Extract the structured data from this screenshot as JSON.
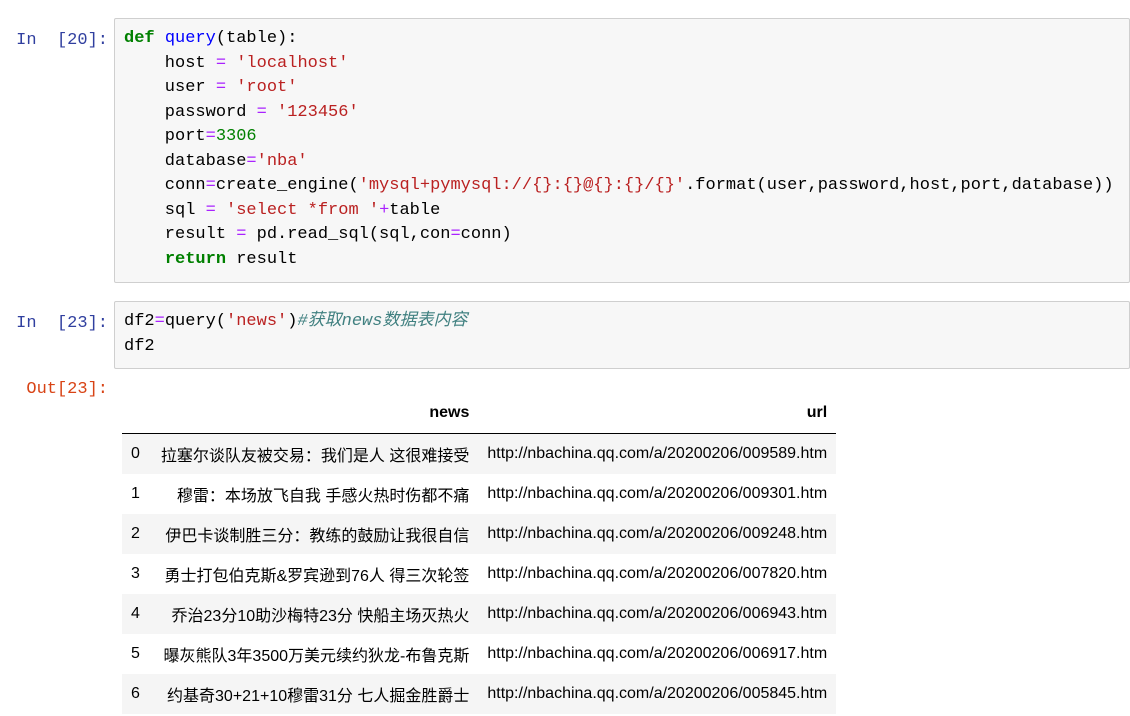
{
  "cells": [
    {
      "prompt": "In  [20]:",
      "lines": [
        "def query(table):",
        "    host = 'localhost'",
        "    user = 'root'",
        "    password = '123456'",
        "    port=3306",
        "    database='nba'",
        "    conn=create_engine('mysql+pymysql://{}:{}@{}:{}/{}'.format(user,password,host,port,database))",
        "    sql = 'select *from '+table",
        "    result = pd.read_sql(sql,con=conn)",
        "    return result"
      ]
    },
    {
      "prompt": "In  [23]:",
      "lines": [
        "df2=query('news')#获取news数据表内容",
        "df2"
      ]
    }
  ],
  "output": {
    "prompt": "Out[23]:",
    "columns": [
      "",
      "news",
      "url"
    ],
    "rows": [
      [
        "0",
        "拉塞尔谈队友被交易：我们是人 这很难接受",
        "http://nbachina.qq.com/a/20200206/009589.htm"
      ],
      [
        "1",
        "穆雷：本场放飞自我 手感火热时伤都不痛",
        "http://nbachina.qq.com/a/20200206/009301.htm"
      ],
      [
        "2",
        "伊巴卡谈制胜三分：教练的鼓励让我很自信",
        "http://nbachina.qq.com/a/20200206/009248.htm"
      ],
      [
        "3",
        "勇士打包伯克斯&罗宾逊到76人 得三次轮签",
        "http://nbachina.qq.com/a/20200206/007820.htm"
      ],
      [
        "4",
        "乔治23分10助沙梅特23分 快船主场灭热火",
        "http://nbachina.qq.com/a/20200206/006943.htm"
      ],
      [
        "5",
        "曝灰熊队3年3500万美元续约狄龙-布鲁克斯",
        "http://nbachina.qq.com/a/20200206/006917.htm"
      ],
      [
        "6",
        "约基奇30+21+10穆雷31分 七人掘金胜爵士",
        "http://nbachina.qq.com/a/20200206/005845.htm"
      ]
    ]
  }
}
